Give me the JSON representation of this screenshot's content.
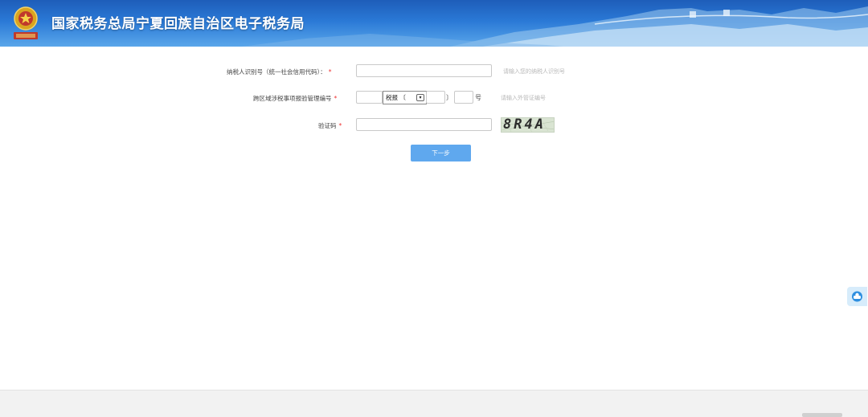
{
  "header": {
    "site_title": "国家税务总局宁夏回族自治区电子税务局",
    "emblem_icon": "tax-emblem-icon"
  },
  "form": {
    "taxpayer_id": {
      "label": "纳税人识别号（统一社会信用代码）：",
      "required_mark": "*",
      "value": "",
      "hint": "请输入您的纳税人识别号"
    },
    "cross_region": {
      "label": "跨区域涉税事项报验管理编号",
      "required_mark": "*",
      "prefix_value": "",
      "select_value": "税报",
      "bracket_open": "〔",
      "year_value": "",
      "bracket_close": "〕",
      "number_value": "",
      "suffix": "号",
      "hint": "请输入外管证编号"
    },
    "captcha": {
      "label": "验证码",
      "required_mark": "*",
      "value": "",
      "image_text": "8R4A"
    },
    "next_button": "下一步"
  },
  "side_widget_icon": "customer-service-icon",
  "colors": {
    "header_dark": "#1e5db9",
    "header_light": "#5aa6ea",
    "button_bg": "#5fa8ee",
    "required": "#e33333"
  }
}
